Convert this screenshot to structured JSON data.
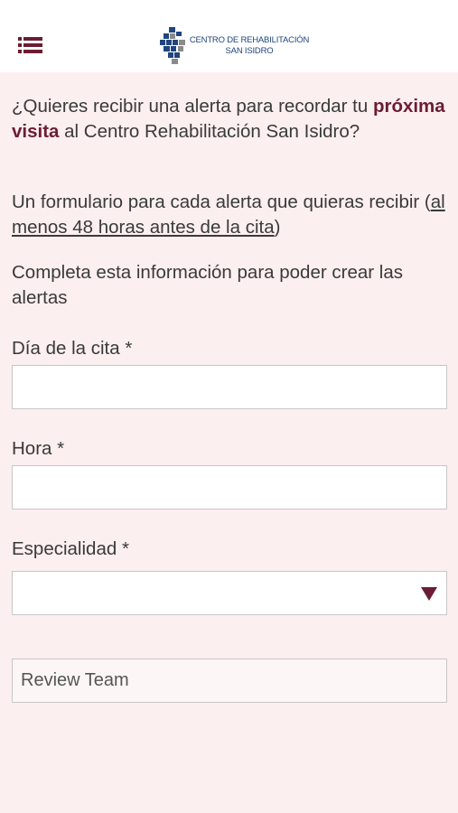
{
  "header": {
    "menu_icon": "hamburger-list-icon",
    "logo": {
      "line1": "CENTRO DE REHABILITACIÓN",
      "line2": "SAN ISIDRO",
      "colors": {
        "blue": "#21457e",
        "gray": "#8a8a8a"
      }
    }
  },
  "intro": {
    "p1_before": "¿Quieres recibir una alerta para recordar tu ",
    "p1_bold": "próxima visita",
    "p1_after": " al Centro Rehabilitación San Isidro?",
    "p2_before": "Un formulario para cada alerta que quieras recibir (",
    "p2_underline": "al menos 48 horas antes de la cita",
    "p2_after": ")",
    "p3": "Completa esta información para poder crear las alertas"
  },
  "form": {
    "date": {
      "label": "Día de la cita *",
      "value": ""
    },
    "time": {
      "label": "Hora *",
      "value": ""
    },
    "specialty": {
      "label": "Especialidad *",
      "selected": ""
    },
    "review_text": "Review Team"
  },
  "colors": {
    "accent": "#6b1d33",
    "background": "#fcefef",
    "text": "#3a3a3a",
    "border": "#c9c6c6"
  }
}
